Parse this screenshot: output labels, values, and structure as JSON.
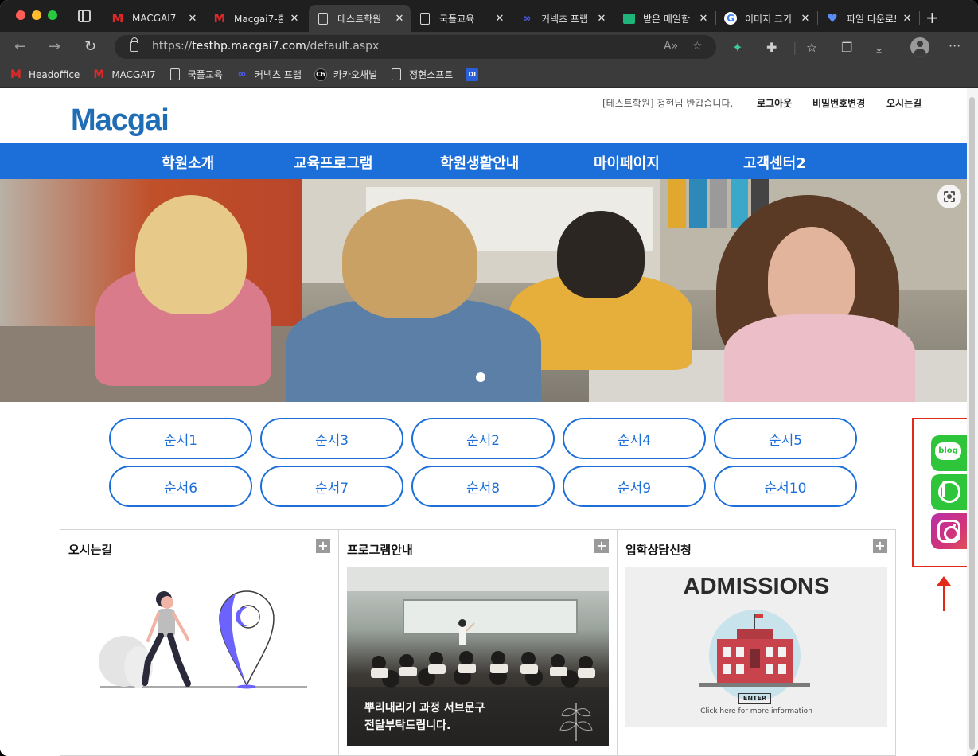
{
  "browser": {
    "tabs": [
      {
        "label": "MACGAI7",
        "icon": "macgai-m-icon"
      },
      {
        "label": "Macgai7-홈",
        "icon": "macgai-m-icon"
      },
      {
        "label": "테스트학원",
        "icon": "page-icon",
        "active": true
      },
      {
        "label": "국플교육",
        "icon": "page-icon"
      },
      {
        "label": "커넥츠 프랩",
        "icon": "infinity-icon"
      },
      {
        "label": "받은 메일함",
        "icon": "mail-icon"
      },
      {
        "label": "이미지 크기",
        "icon": "google-icon"
      },
      {
        "label": "파일 다운로드",
        "icon": "heart-icon"
      }
    ],
    "url_host": "testhp.macgai7.com",
    "url_path": "/default.aspx",
    "url_scheme": "https://",
    "bookmarks": [
      {
        "label": "Headoffice",
        "icon": "macgai-m-icon"
      },
      {
        "label": "MACGAI7",
        "icon": "macgai-m-icon"
      },
      {
        "label": "국플교육",
        "icon": "page-icon"
      },
      {
        "label": "커넥츠 프랩",
        "icon": "infinity-icon"
      },
      {
        "label": "카카오채널",
        "icon": "ch-icon"
      },
      {
        "label": "정현소프트",
        "icon": "page-icon"
      },
      {
        "label": "",
        "icon": "di-icon",
        "icon_text": "DI"
      }
    ]
  },
  "site": {
    "logo": "Macgai",
    "greeting": "[테스트학원] 정현님 반갑습니다.",
    "util_links": {
      "logout": "로그아웃",
      "change_password": "비밀번호변경",
      "directions": "오시는길"
    },
    "nav": [
      "학원소개",
      "교육프로그램",
      "학원생활안내",
      "마이페이지",
      "고객센터2"
    ],
    "order_buttons": [
      "순서1",
      "순서3",
      "순서2",
      "순서4",
      "순서5",
      "순서6",
      "순서7",
      "순서8",
      "순서9",
      "순서10"
    ],
    "panels": {
      "directions": {
        "title": "오시는길"
      },
      "program": {
        "title": "프로그램안내",
        "caption_line1": "뿌리내리기 과정 서브문구",
        "caption_line2": "전달부탁드립니다."
      },
      "admission": {
        "title": "입학상담신청",
        "image_title": "ADMISSIONS",
        "enter_label": "ENTER",
        "sub_text": "Click here for more information"
      }
    },
    "social": {
      "blog_label": "blog"
    },
    "colors": {
      "brand_blue": "#1c6fd8",
      "logo_blue": "#1f6db5",
      "annotation_red": "#e12a1a"
    }
  }
}
